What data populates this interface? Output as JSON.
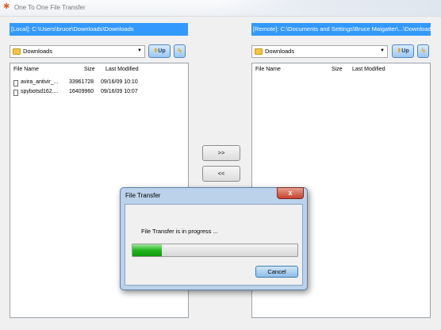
{
  "window": {
    "title": "One To One File Transfer"
  },
  "local": {
    "path": "[Local]: C:\\Users\\bruce\\Downloads\\Downloads",
    "folder": "Downloads",
    "up_label": "Up",
    "columns": [
      "File Name",
      "Size",
      "Last Modified"
    ],
    "files": [
      {
        "name": "avira_antivir_...",
        "size": "33961728",
        "modified": "09/16/09  10:10"
      },
      {
        "name": "spybotsd162....",
        "size": "16409960",
        "modified": "09/16/09  10:07"
      }
    ]
  },
  "remote": {
    "path": "[Remote]: C:\\Documents and Settings\\Bruce Maigatter\\...\\Downloads",
    "folder": "Downloads",
    "up_label": "Up",
    "columns": [
      "File Name",
      "Size",
      "Last Modified"
    ]
  },
  "transfer": {
    "send_label": ">>",
    "receive_label": "<<"
  },
  "dialog": {
    "title": "File Transfer",
    "close_glyph": "x",
    "message": "File Transfer is in progress ...",
    "progress": 0.18,
    "cancel_label": "Cancel"
  },
  "colors": {
    "path_bar": "#3399ff",
    "progress_fill": "#22b51f"
  }
}
